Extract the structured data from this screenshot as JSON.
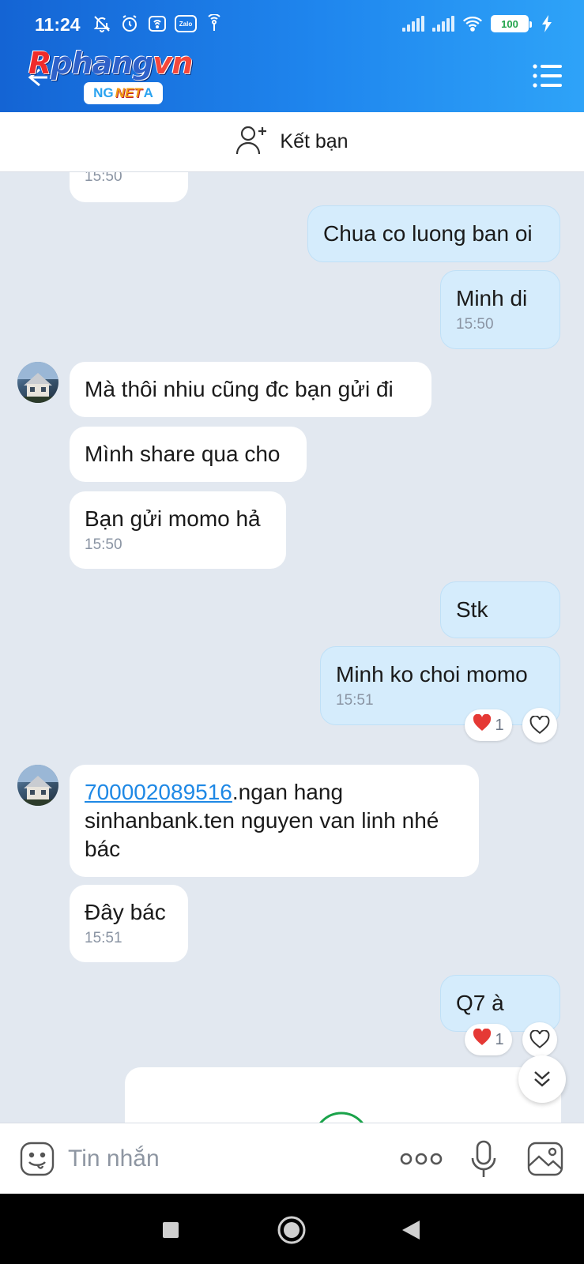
{
  "status_bar": {
    "time": "11:24",
    "battery": "100",
    "icons_left": [
      "mute-bell-icon",
      "alarm-icon",
      "wifi-hotspot-icon",
      "zalo-icon",
      "hotspot-icon"
    ],
    "zalo_text": "Zalo",
    "icons_right": [
      "signal-icon",
      "signal-icon",
      "wifi-icon",
      "battery-icon",
      "charging-icon"
    ]
  },
  "header": {
    "logo_brand_first": "R",
    "logo_brand_rest": "phang",
    "logo_brand_tail": "vn",
    "logo_sub_left": "NG",
    "logo_sub_mid": "NET",
    "logo_sub_right": "A"
  },
  "add_friend": {
    "label": "Kết bạn"
  },
  "messages": {
    "m0_time": "15:50",
    "m1_text": "Chua co luong ban oi",
    "m2_text": "Minh di",
    "m2_time": "15:50",
    "m3_text": "Mà thôi nhiu cũng đc bạn gửi đi",
    "m4_text": "Mình share qua cho",
    "m5_text": "Bạn gửi momo hả",
    "m5_time": "15:50",
    "m6_text": "Stk",
    "m7_text": "Minh ko choi momo",
    "m7_time": "15:51",
    "m7_reaction_count": "1",
    "m8_link": "700002089516",
    "m8_text_line1": ".ngan hang",
    "m8_text_rest": "sinhanbank.ten nguyen van linh nhé bác",
    "m9_text": "Đây bác",
    "m9_time": "15:51",
    "m10_text": "Q7 à",
    "m10_reaction_count": "1"
  },
  "input_bar": {
    "placeholder": "Tin nhắn"
  },
  "colors": {
    "header_start": "#1464d4",
    "header_end": "#2ea3f8",
    "bubble_out": "#d5ecfc",
    "bubble_in": "#ffffff",
    "chat_bg": "#e2e8f0",
    "link": "#1e88e5",
    "reaction_heart": "#e53935"
  }
}
